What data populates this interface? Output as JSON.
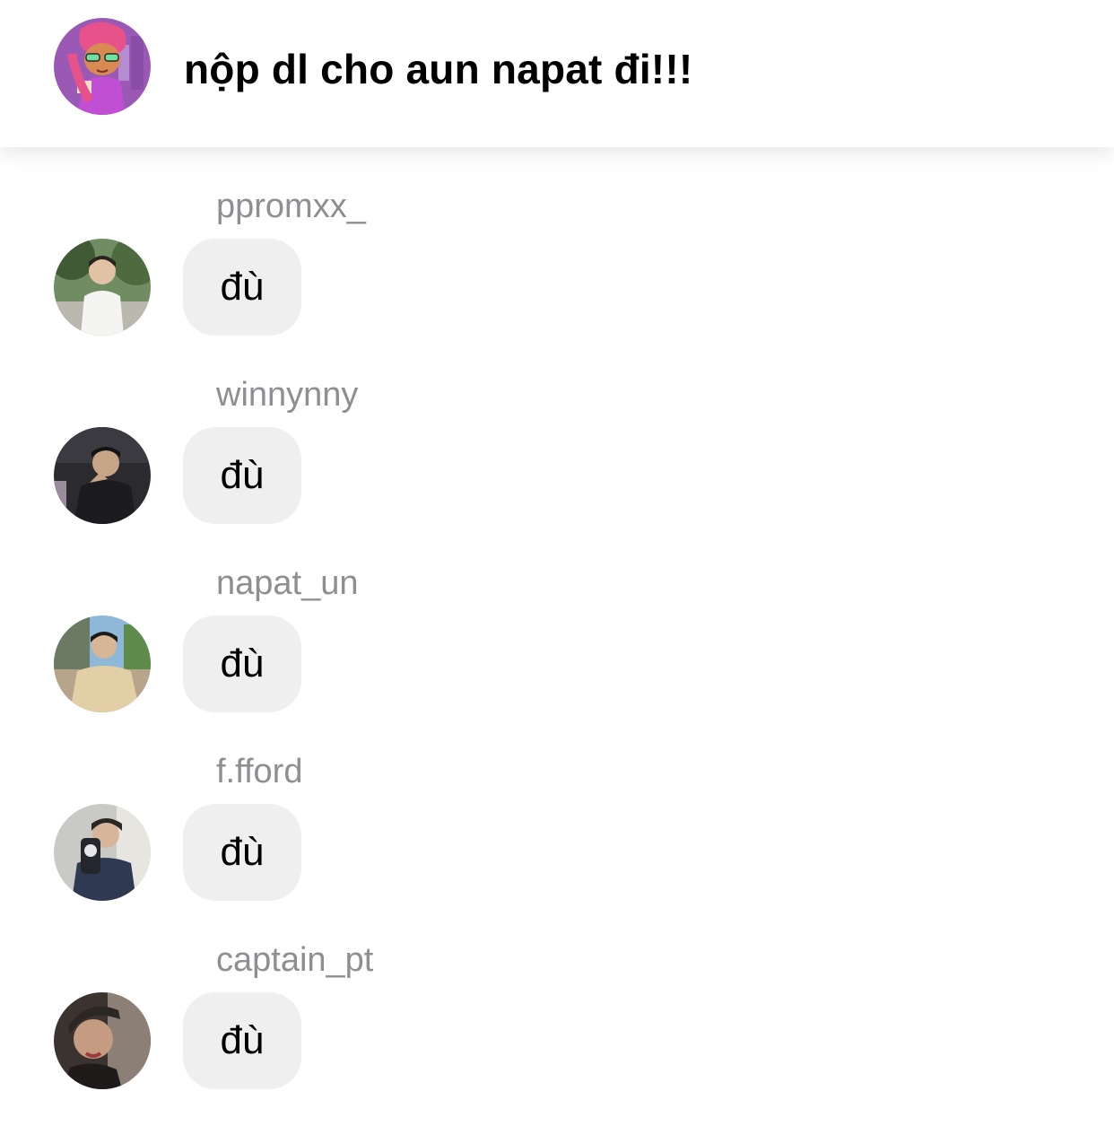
{
  "header": {
    "title": "nộp dl cho aun napat đi!!!",
    "avatar_name": "group-avatar"
  },
  "messages": [
    {
      "sender": "ppromxx_",
      "text": "đù"
    },
    {
      "sender": "winnynny",
      "text": "đù"
    },
    {
      "sender": "napat_un",
      "text": "đù"
    },
    {
      "sender": "f.fford",
      "text": "đù"
    },
    {
      "sender": "captain_pt",
      "text": "đù"
    }
  ],
  "colors": {
    "background": "#ffffff",
    "sender_text": "#8e8e93",
    "bubble": "#efefef",
    "message_text": "#000000",
    "group_avatar_bg": "#9b59b6"
  }
}
